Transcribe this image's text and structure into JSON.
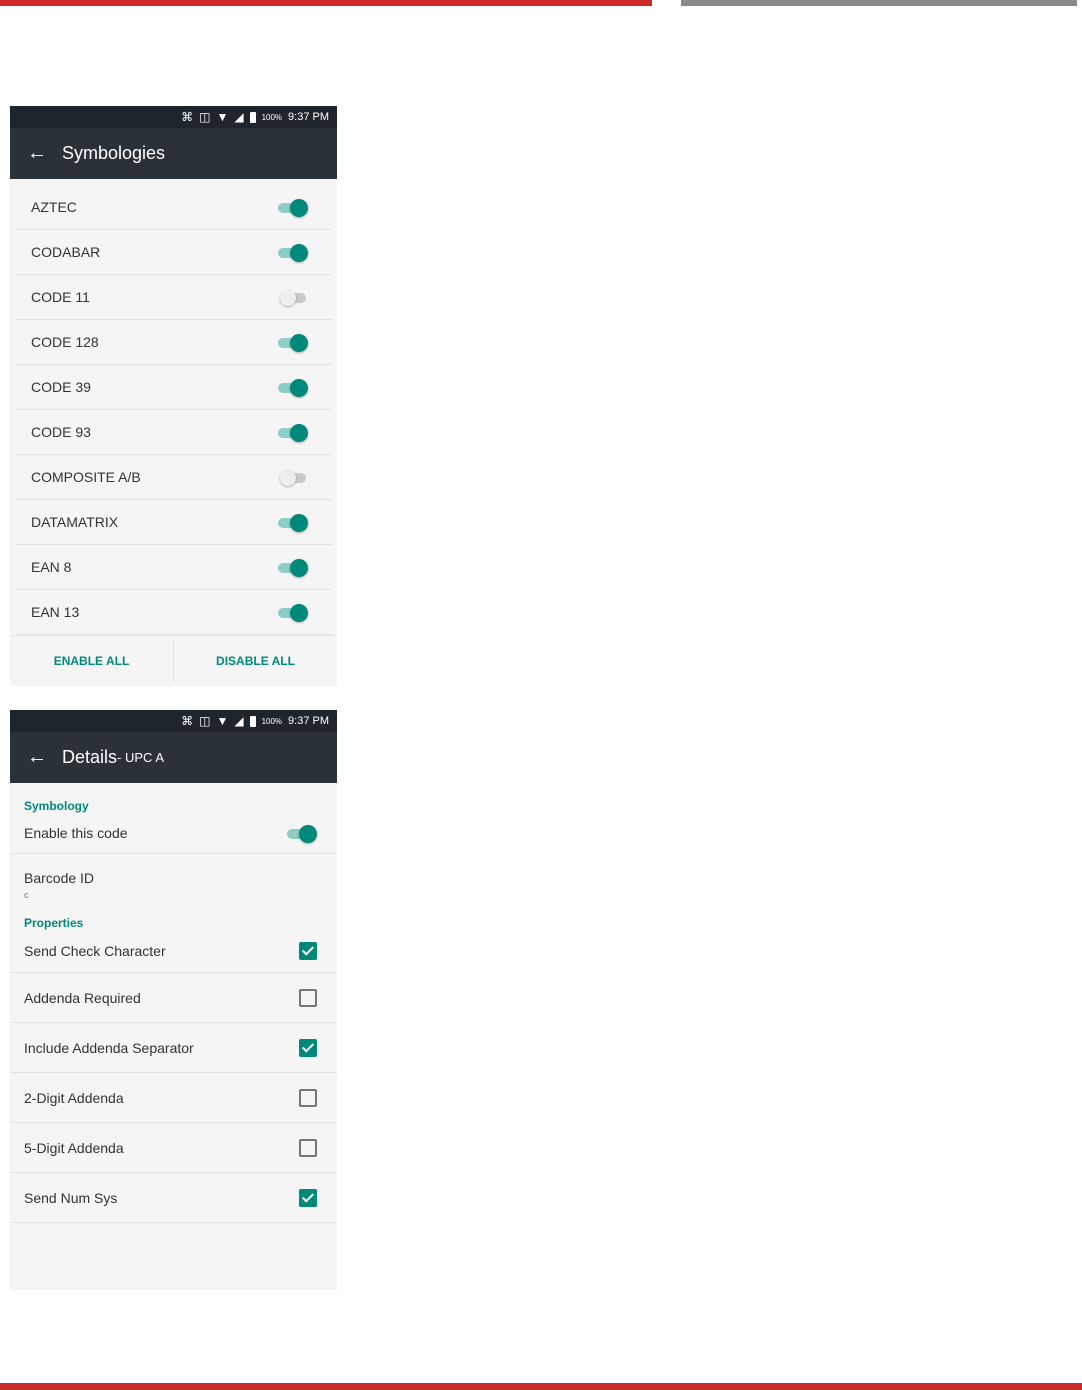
{
  "status_bar": {
    "battery": "100%",
    "time": "9:37 PM"
  },
  "screen1": {
    "title": "Symbologies",
    "items": [
      {
        "label": "AZTEC",
        "enabled": true
      },
      {
        "label": "CODABAR",
        "enabled": true
      },
      {
        "label": "CODE 11",
        "enabled": false
      },
      {
        "label": "CODE 128",
        "enabled": true
      },
      {
        "label": "CODE 39",
        "enabled": true
      },
      {
        "label": "CODE 93",
        "enabled": true
      },
      {
        "label": "COMPOSITE A/B",
        "enabled": false
      },
      {
        "label": "DATAMATRIX",
        "enabled": true
      },
      {
        "label": "EAN 8",
        "enabled": true
      },
      {
        "label": "EAN 13",
        "enabled": true
      }
    ],
    "enable_all": "ENABLE ALL",
    "disable_all": "DISABLE ALL"
  },
  "screen2": {
    "title": "Details",
    "subtitle": " - UPC A",
    "symbology_header": "Symbology",
    "enable_code": {
      "label": "Enable this code",
      "enabled": true
    },
    "barcode_id": {
      "label": "Barcode ID",
      "value": "c"
    },
    "properties_header": "Properties",
    "properties": [
      {
        "label": "Send Check Character",
        "checked": true
      },
      {
        "label": "Addenda Required",
        "checked": false
      },
      {
        "label": "Include Addenda Separator",
        "checked": true
      },
      {
        "label": "2-Digit Addenda",
        "checked": false
      },
      {
        "label": "5-Digit Addenda",
        "checked": false
      },
      {
        "label": "Send Num Sys",
        "checked": true
      }
    ]
  },
  "colors": {
    "accent": "#00897b",
    "appbar": "#2a3238",
    "page_rule_red": "#cc2a2a",
    "page_rule_grey": "#8a8a8a"
  }
}
